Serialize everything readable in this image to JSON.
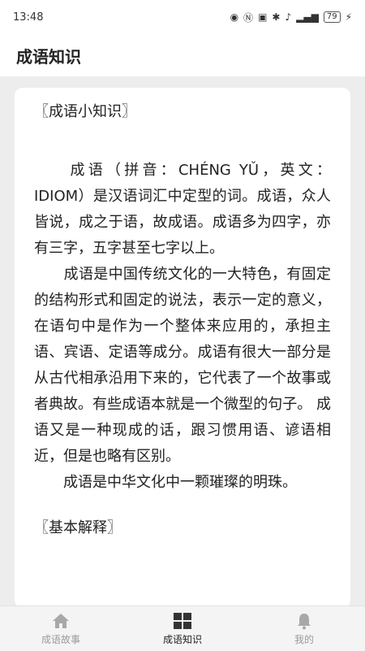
{
  "status_bar": {
    "time": "13:48",
    "battery": "79"
  },
  "app_bar": {
    "title": "成语知识"
  },
  "article": {
    "heading1": "〖成语小知识〗",
    "paragraphs": [
      "　　成语（拼音：CHÉNG YǓ，英文：IDIOM）是汉语词汇中定型的词。成语，众人皆说，成之于语，故成语。成语多为四字，亦有三字，五字甚至七字以上。",
      "　　成语是中国传统文化的一大特色，有固定的结构形式和固定的说法，表示一定的意义，在语句中是作为一个整体来应用的，承担主语、宾语、定语等成分。成语有很大一部分是从古代相承沿用下来的，它代表了一个故事或者典故。有些成语本就是一个微型的句子。 成语又是一种现成的话，跟习惯用语、谚语相近，但是也略有区别。",
      "　　成语是中华文化中一颗璀璨的明珠。"
    ],
    "heading2": "〖基本解释〗"
  },
  "bottom_nav": {
    "items": [
      {
        "label": "成语故事",
        "icon": "home-icon"
      },
      {
        "label": "成语知识",
        "icon": "grid-icon"
      },
      {
        "label": "我的",
        "icon": "bell-icon"
      }
    ],
    "active_index": 1
  },
  "colors": {
    "active": "#222222",
    "inactive": "#9a9a9a"
  }
}
